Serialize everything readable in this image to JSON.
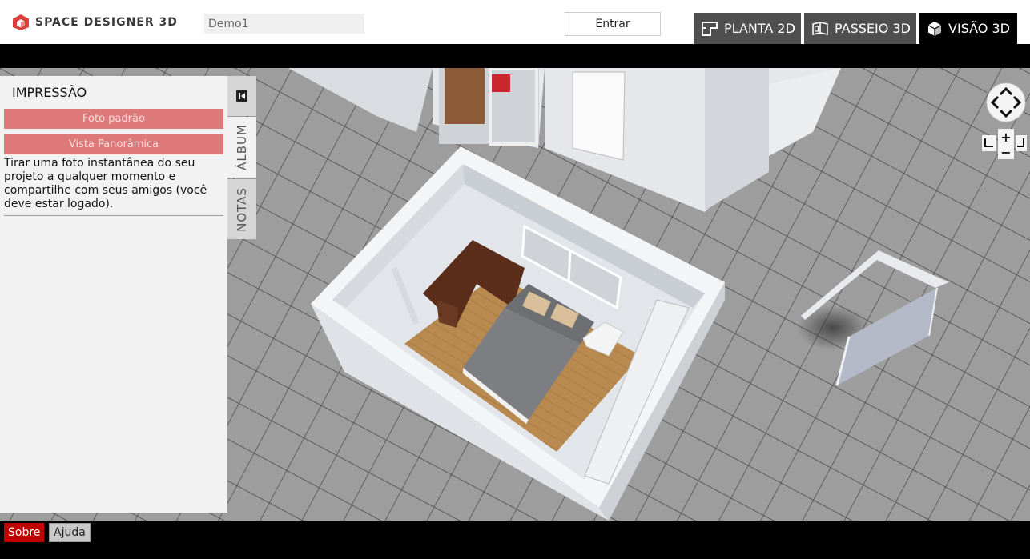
{
  "header": {
    "brand": "SPACE DESIGNER 3D",
    "project_name": "Demo1",
    "login_label": "Entrar",
    "view_tabs": [
      {
        "label": "PLANTA 2D",
        "icon": "floorplan-icon",
        "active": false
      },
      {
        "label": "PASSEIO 3D",
        "icon": "walkthrough-icon",
        "active": false
      },
      {
        "label": "VISÃO 3D",
        "icon": "cube-icon",
        "active": true
      }
    ]
  },
  "panel": {
    "title": "IMPRESSÃO",
    "buttons": [
      "Foto padrão",
      "Vista Panorâmica"
    ],
    "description": "Tirar uma foto instantânea do seu projeto a qualquer momento e compartilhe com seus amigos (você deve estar logado).",
    "side_tabs": [
      "ÁLBUM",
      "NOTAS"
    ],
    "active_side_tab": "ÁLBUM"
  },
  "nav_controls": {
    "zoom_in": "+",
    "zoom_out": "−",
    "icons": [
      "pan-arrows-icon",
      "zoom-in-icon",
      "zoom-out-icon",
      "rotate-left-icon",
      "rotate-right-icon"
    ]
  },
  "footer": {
    "about_label": "Sobre",
    "help_label": "Ajuda"
  },
  "colors": {
    "brand_red": "#d9403a",
    "panel_button": "#de7979",
    "active_tab": "#000000",
    "inactive_tab": "#4f4f4f",
    "about_button": "#c00000"
  }
}
